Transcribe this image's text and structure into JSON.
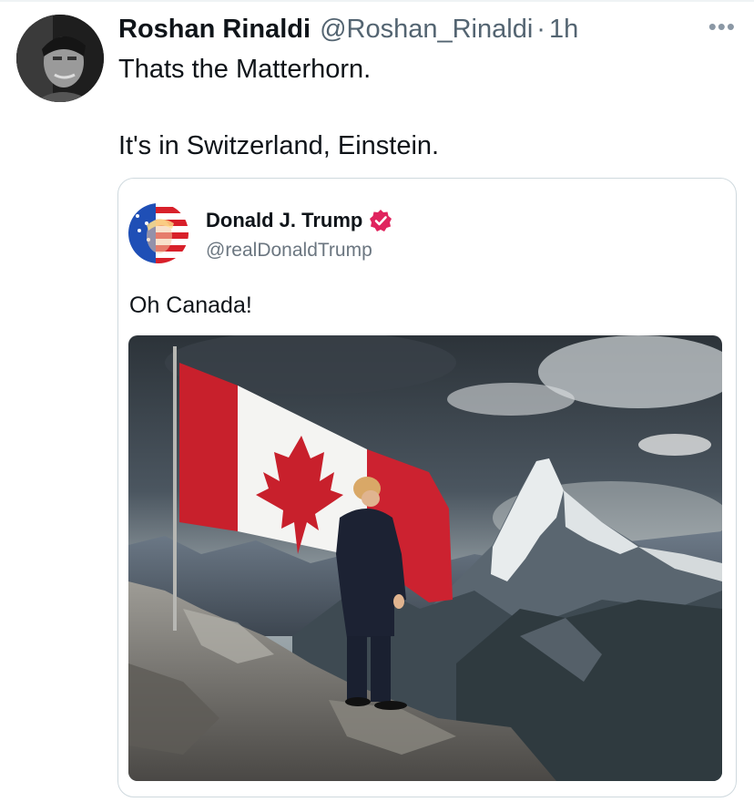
{
  "tweet": {
    "author_name": "Roshan Rinaldi",
    "author_handle": "@Roshan_Rinaldi",
    "separator": "·",
    "time": "1h",
    "more_label": "•••",
    "text_line1": "Thats the Matterhorn.",
    "text_line2": "It's in Switzerland, Einstein."
  },
  "quoted_tweet": {
    "author_name": "Donald J. Trump",
    "author_handle": "@realDonaldTrump",
    "text": "Oh Canada!",
    "verified_badge_color": "#e0245e"
  },
  "icons": {
    "more": "more-options-icon",
    "verified": "verified-badge-icon"
  }
}
